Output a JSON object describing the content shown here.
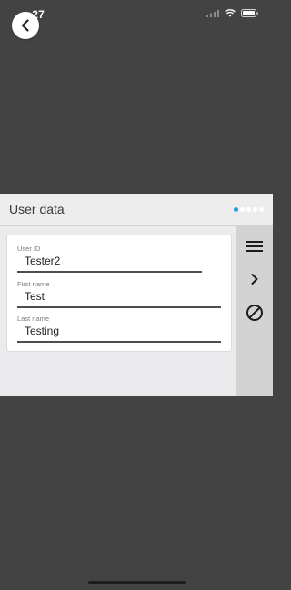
{
  "status_bar": {
    "time": ":27"
  },
  "card": {
    "title": "User data",
    "page_count": 5,
    "active_page": 1
  },
  "fields": [
    {
      "label": "User ID",
      "value": "Tester2"
    },
    {
      "label": "First name",
      "value": "Test"
    },
    {
      "label": "Last name",
      "value": "Testing"
    }
  ],
  "toolbar": {
    "icons": [
      "menu-icon",
      "chevron-right-icon",
      "block-icon"
    ]
  },
  "colors": {
    "background": "#434343",
    "card": "#ededed",
    "toolbar": "#d3d3d3",
    "accent": "#2b9be0"
  }
}
